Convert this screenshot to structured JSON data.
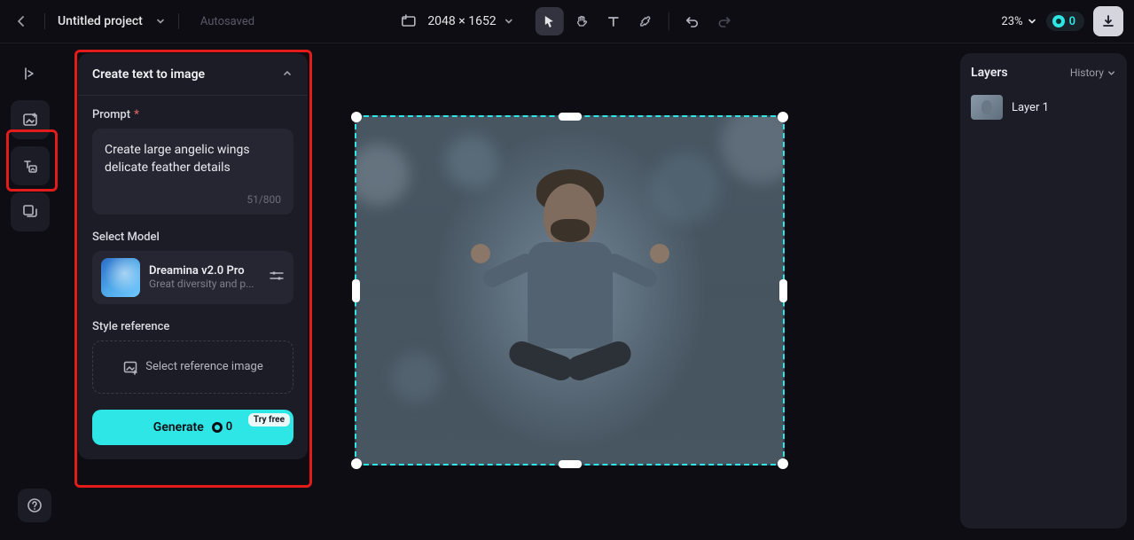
{
  "header": {
    "project_title": "Untitled project",
    "autosaved_label": "Autosaved",
    "dimensions": "2048 × 1652",
    "zoom": "23%",
    "credits": "0"
  },
  "panel": {
    "title": "Create text to image",
    "prompt_label": "Prompt",
    "prompt_text": "Create large angelic wings delicate feather details",
    "char_count": "51/800",
    "select_model_label": "Select Model",
    "model_name": "Dreamina v2.0 Pro",
    "model_desc": "Great diversity and p...",
    "style_ref_label": "Style reference",
    "style_ref_placeholder": "Select reference image",
    "generate_label": "Generate",
    "generate_cost": "0",
    "try_free_label": "Try free"
  },
  "right": {
    "layers_label": "Layers",
    "history_label": "History",
    "layers": [
      {
        "name": "Layer 1"
      }
    ]
  }
}
